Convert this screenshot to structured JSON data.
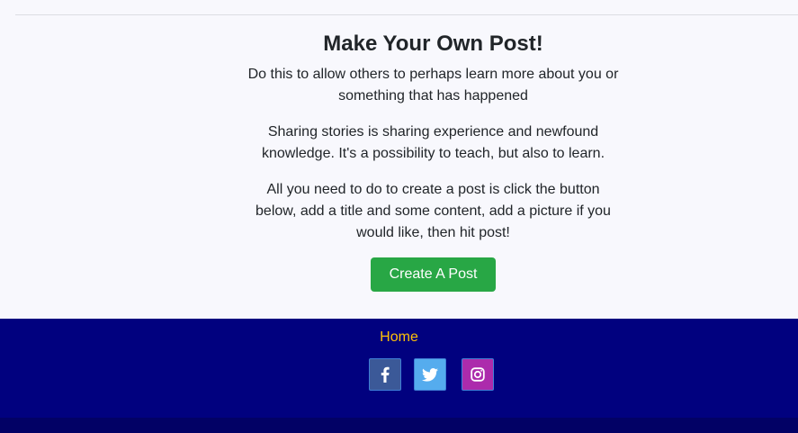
{
  "post_section": {
    "title": "Make Your Own Post!",
    "paragraph_1": "Do this to allow others to perhaps learn more about you or something that has happened",
    "paragraph_2": "Sharing stories is sharing experience and newfound knowledge. It's a possibility to teach, but also to learn.",
    "paragraph_3": "All you need to do to create a post is click the button below, add a title and some content, add a picture if you would like, then hit post!",
    "create_button_label": "Create A Post"
  },
  "footer": {
    "home_link": "Home",
    "social_links": [
      {
        "icon": "facebook-icon",
        "color": "#3b5998"
      },
      {
        "icon": "twitter-icon",
        "color": "#55acee"
      },
      {
        "icon": "instagram-icon",
        "color": "#ac2bac"
      }
    ],
    "background_color": "#01017f",
    "link_color": "#ffc107"
  },
  "colors": {
    "page_background": "#f8f8fd",
    "button_green": "#28a745"
  }
}
